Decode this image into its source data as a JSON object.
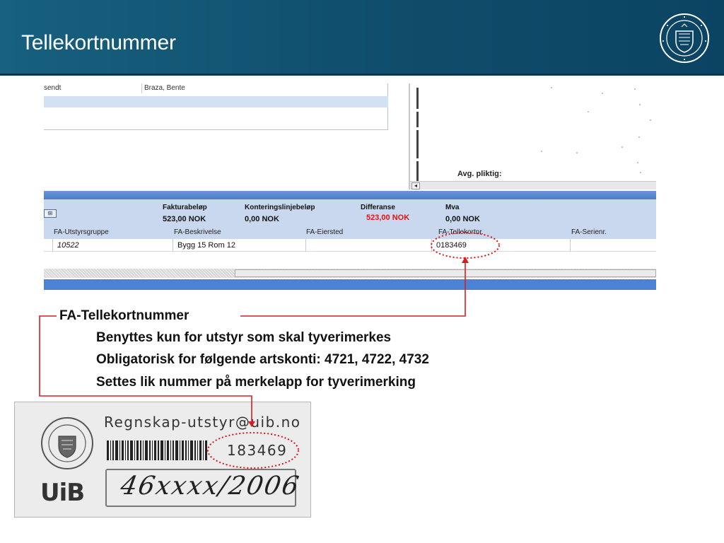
{
  "slide": {
    "title": "Tellekortnummer",
    "logo_text": "UNIVERSITAS BERGENSIS"
  },
  "screenshot": {
    "top_row": {
      "col1": "sendt",
      "col2": "Braza, Bente"
    },
    "scan_note": "Avg. pliktig:",
    "summary_headers": [
      "Fakturabeløp",
      "Konteringslinjebeløp",
      "Differanse",
      "Mva"
    ],
    "summary_values": [
      "523,00 NOK",
      "0,00 NOK",
      "523,00 NOK",
      "0,00 NOK"
    ],
    "columns": [
      "FA-Utstyrsgruppe",
      "FA-Beskrivelse",
      "FA-Eiersted",
      "FA-Tellekortnr.",
      "FA-Serienr."
    ],
    "row": [
      "10522",
      "Bygg 15 Rom 12",
      "",
      "0183469",
      ""
    ]
  },
  "annotation": {
    "title": "FA-Tellekortnummer",
    "bullets": [
      "Benyttes kun for utstyr som skal tyverimerkes",
      "Obligatorisk for følgende artskonti: 4721, 4722, 4732",
      "Settes lik nummer på merkelapp for tyverimerking"
    ]
  },
  "label_photo": {
    "email": "Regnskap-utstyr@uib.no",
    "number": "183469",
    "handwritten": "46xxxx/2006",
    "logo": "UiB"
  },
  "colors": {
    "header_bg": "#155a7a",
    "highlight_red": "#e01414",
    "panel_bg": "#c9d8ef",
    "bar_blue": "#4b82d4"
  }
}
